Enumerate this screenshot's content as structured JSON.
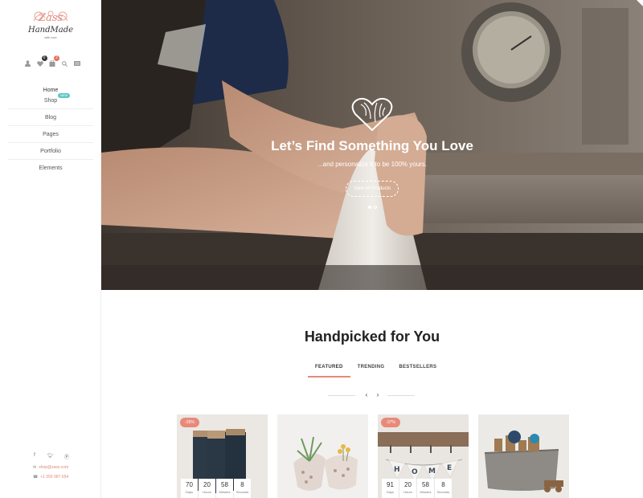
{
  "brand": {
    "name": "Zass",
    "sub": "HandMade",
    "tagline": "with love",
    "accent": "#e8897a",
    "teal": "#5ec4c8"
  },
  "header_icons": {
    "user": "user-icon",
    "wishlist": "heart-icon",
    "wishlist_count": "0",
    "cart": "cart-icon",
    "cart_count": "2",
    "search": "search-icon",
    "menu": "menu-icon"
  },
  "nav": {
    "items": [
      {
        "label": "Home"
      },
      {
        "label": "Shop",
        "badge": "NEW"
      },
      {
        "label": "Blog"
      },
      {
        "label": "Pages"
      },
      {
        "label": "Portfolio"
      },
      {
        "label": "Elements"
      }
    ]
  },
  "social": [
    "facebook-icon",
    "twitter-icon",
    "pinterest-icon"
  ],
  "contact": {
    "email": "shop@zass.com",
    "phone": "+1 555 987 654"
  },
  "hero": {
    "title": "Let’s Find Something You Love",
    "subtitle": "...and personalize it to be 100% yours.",
    "button": "View All Products",
    "slide_count": 2,
    "active_slide": 1
  },
  "section": {
    "title": "Handpicked for You",
    "tabs": [
      {
        "label": "FEATURED",
        "active": true
      },
      {
        "label": "TRENDING",
        "active": false
      },
      {
        "label": "BESTSELLERS",
        "active": false
      }
    ],
    "prev": "‹",
    "next": "›"
  },
  "products": [
    {
      "sale": "-25%",
      "countdown": [
        {
          "n": "70",
          "l": "Days"
        },
        {
          "n": "20",
          "l": "Hours"
        },
        {
          "n": "58",
          "l": "Minutes"
        },
        {
          "n": "8",
          "l": "Seconds"
        }
      ]
    },
    {
      "sale": "",
      "countdown": []
    },
    {
      "sale": "-37%",
      "countdown": [
        {
          "n": "91",
          "l": "Days"
        },
        {
          "n": "20",
          "l": "Hours"
        },
        {
          "n": "58",
          "l": "Minutes"
        },
        {
          "n": "8",
          "l": "Seconds"
        }
      ]
    },
    {
      "sale": "",
      "countdown": []
    }
  ]
}
